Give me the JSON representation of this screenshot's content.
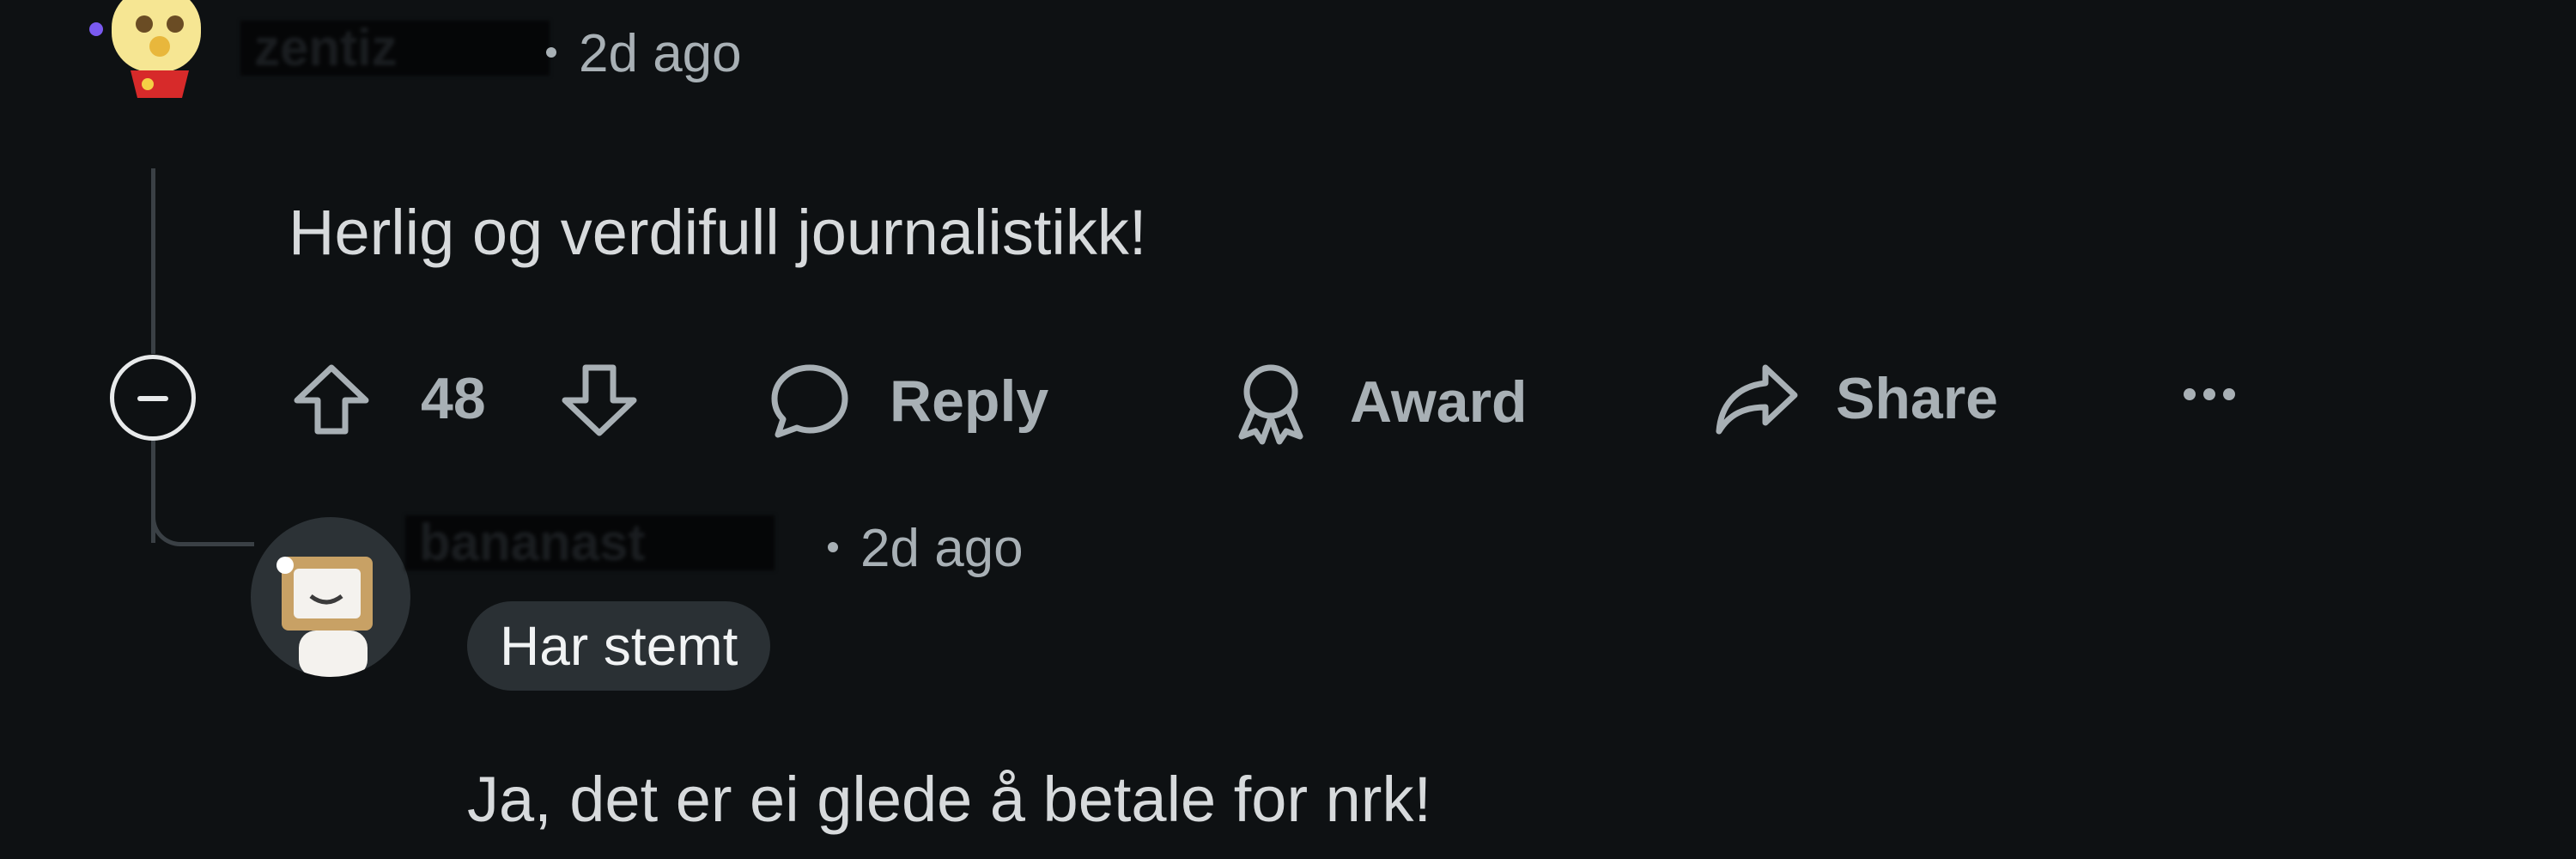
{
  "comment": {
    "username": "zentiz",
    "time_ago": "2d ago",
    "text": "Herlig og verdifull journalistikk!",
    "score": "48",
    "actions": {
      "reply_label": "Reply",
      "award_label": "Award",
      "share_label": "Share"
    }
  },
  "reply": {
    "username": "bananast",
    "time_ago": "2d ago",
    "flair": "Har stemt",
    "text": "Ja, det er ei glede å betale for nrk!"
  },
  "colors": {
    "background": "#0e1113",
    "text": "#d7dadc",
    "muted": "#a8b0b5",
    "thread_line": "#3a4045",
    "flair_bg": "#2a3034"
  },
  "icons": {
    "upvote": "arrow-up-icon",
    "downvote": "arrow-down-icon",
    "reply": "speech-bubble-icon",
    "award": "award-ribbon-icon",
    "share": "share-arrow-icon",
    "more": "ellipsis-icon",
    "collapse": "minus-circle-icon"
  }
}
